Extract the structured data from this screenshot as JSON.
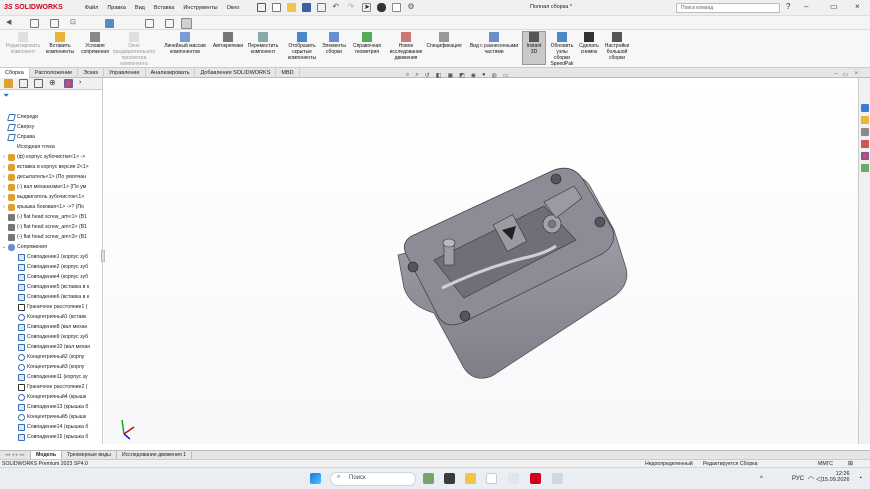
{
  "app": {
    "brand": "SOLIDWORKS",
    "document_title": "Полная сборка *",
    "search_placeholder": "Поиск команд"
  },
  "menu": [
    "Файл",
    "Правка",
    "Вид",
    "Вставка",
    "Инструменты",
    "Окно"
  ],
  "commands": [
    {
      "label": "Редактировать компонент",
      "disabled": true
    },
    {
      "label": "Вставить компоненты",
      "disabled": false
    },
    {
      "label": "Условия сопряжения",
      "disabled": false
    },
    {
      "label": "Окно предварительного просмотра компонента",
      "disabled": true
    },
    {
      "label": "Линейный массив компонентов",
      "disabled": false
    },
    {
      "label": "Автокрепежи",
      "disabled": false
    },
    {
      "label": "Переместить компонент",
      "disabled": false
    },
    {
      "label": "Отобразить скрытые компоненты",
      "disabled": false
    },
    {
      "label": "Элементы сборки",
      "disabled": false
    },
    {
      "label": "Справочная геометрия",
      "disabled": false
    },
    {
      "label": "Новое исследование движения",
      "disabled": false
    },
    {
      "label": "Спецификация",
      "disabled": false
    },
    {
      "label": "Вид с разнесенными частями",
      "disabled": false
    },
    {
      "label": "Instant 3D",
      "disabled": false,
      "active": true
    },
    {
      "label": "Обновить узлы сборки SpeedPak",
      "disabled": false
    },
    {
      "label": "Сделать снимок",
      "disabled": false
    },
    {
      "label": "Настройки большой сборки",
      "disabled": false
    }
  ],
  "tabs": [
    "Сборка",
    "Расположение",
    "Эскиз",
    "Управление",
    "Анализировать",
    "Добавления SOLIDWORKS",
    "MBD"
  ],
  "tree": [
    {
      "label": "Спереди",
      "icon": "plane",
      "arrow": ""
    },
    {
      "label": "Сверху",
      "icon": "plane",
      "arrow": ""
    },
    {
      "label": "Справа",
      "icon": "plane",
      "arrow": ""
    },
    {
      "label": "Исходная точка",
      "icon": "origin",
      "arrow": ""
    },
    {
      "label": "(ф) корпус зубочистки<1> ->",
      "icon": "part",
      "arrow": "›"
    },
    {
      "label": "вставка в корпус версия 2<1>",
      "icon": "part",
      "arrow": "›"
    },
    {
      "label": "десыпатель<1> (По умолчан",
      "icon": "part",
      "arrow": "›"
    },
    {
      "label": "(-) вал механизма<1> (По ум",
      "icon": "part",
      "arrow": "›"
    },
    {
      "label": "выдвигатель зубочисток<1>",
      "icon": "part",
      "arrow": "›"
    },
    {
      "label": "крышка боковая<1> ->? (По",
      "icon": "part",
      "arrow": "›"
    },
    {
      "label": "(-) flat head screw_am<1> (B1",
      "icon": "screw",
      "arrow": ""
    },
    {
      "label": "(-) flat head screw_am<2> (B1",
      "icon": "screw",
      "arrow": ""
    },
    {
      "label": "(-) flat head screw_am<3> (B1",
      "icon": "screw",
      "arrow": ""
    },
    {
      "label": "Сопряжения",
      "icon": "mates",
      "arrow": "⌄"
    },
    {
      "label": "Совпадение1 (корпус зуб",
      "icon": "coincident",
      "arrow": ""
    },
    {
      "label": "Совпадение2 (корпус зуб",
      "icon": "coincident",
      "arrow": ""
    },
    {
      "label": "Совпадение4 (корпус зуб",
      "icon": "coincident",
      "arrow": ""
    },
    {
      "label": "Совпадение5 (вставка в к",
      "icon": "coincident",
      "arrow": ""
    },
    {
      "label": "Совпадение6 (вставка в к",
      "icon": "coincident",
      "arrow": ""
    },
    {
      "label": "Граничное расстояние1 (",
      "icon": "distance",
      "arrow": ""
    },
    {
      "label": "Концентричный1 (вставк",
      "icon": "concentric",
      "arrow": ""
    },
    {
      "label": "Совпадение8 (вал механ",
      "icon": "coincident",
      "arrow": ""
    },
    {
      "label": "Совпадение9 (корпус зуб",
      "icon": "coincident",
      "arrow": ""
    },
    {
      "label": "Совпадение10 (вал механ",
      "icon": "coincident",
      "arrow": ""
    },
    {
      "label": "Концентричный2 (корпу",
      "icon": "concentric",
      "arrow": ""
    },
    {
      "label": "Концентричный3 (корпу",
      "icon": "concentric",
      "arrow": ""
    },
    {
      "label": "Совпадение11 (корпус зу",
      "icon": "coincident",
      "arrow": ""
    },
    {
      "label": "Граничное расстояние2 (",
      "icon": "distance",
      "arrow": ""
    },
    {
      "label": "Концентричный4 (крышк",
      "icon": "concentric",
      "arrow": ""
    },
    {
      "label": "Совпадение13 (крышка б",
      "icon": "coincident",
      "arrow": ""
    },
    {
      "label": "Концентричный5 (крышк",
      "icon": "concentric",
      "arrow": ""
    },
    {
      "label": "Совпадение14 (крышка б",
      "icon": "coincident",
      "arrow": ""
    },
    {
      "label": "Совпадение15 (крышка б",
      "icon": "coincident",
      "arrow": ""
    }
  ],
  "bottom_tabs": [
    "Модель",
    "Трехмерные виды",
    "Исследование движения 1"
  ],
  "status": {
    "version": "SOLIDWORKS Premium 2023 SP4.0",
    "state": "Недоопределенный",
    "editing": "Редактируется Сборка",
    "units": "ММГС"
  },
  "taskbar": {
    "search_label": "Поиск",
    "lang": "РУС",
    "time": "12:26",
    "date": "15.09.2026"
  },
  "colors": {
    "model": "#8e8e96",
    "accent": "#d0021b"
  }
}
